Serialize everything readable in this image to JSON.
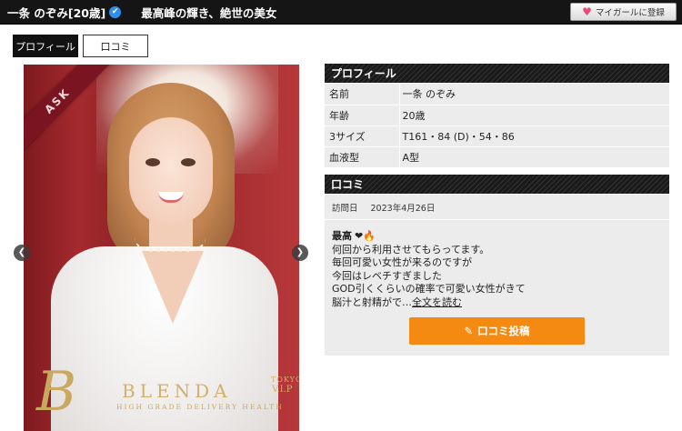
{
  "header": {
    "name": "一条 のぞみ[20歳]",
    "verified_icon": "✔",
    "catchphrase": "最高峰の輝き、絶世の美女",
    "favorite_button": "マイガールに登録"
  },
  "tabs": [
    {
      "label": "プロフィール",
      "active": true
    },
    {
      "label": "口コミ",
      "active": false
    }
  ],
  "photo": {
    "ribbon": "ASK",
    "brand_mark": "B",
    "brand_name": "BLENDA",
    "brand_tokyo": "TOKYO",
    "brand_vip": "V.I.P",
    "brand_tagline": "HIGH GRADE DELIVERY HEALTH"
  },
  "profile": {
    "title": "プロフィール",
    "rows": [
      {
        "key": "名前",
        "value": "一条 のぞみ"
      },
      {
        "key": "年齢",
        "value": "20歳"
      },
      {
        "key": "3サイズ",
        "value": "T161・84 (D)・54・86"
      },
      {
        "key": "血液型",
        "value": "A型"
      }
    ]
  },
  "review": {
    "title": "口コミ",
    "visit_label": "訪問日",
    "visit_date": "2023年4月26日",
    "heading": "最高",
    "heading_emoji": "❤🔥",
    "lines": [
      "何回から利用させてもらってます。",
      "毎回可愛い女性が来るのですが",
      "今回はレベチすぎました",
      "GOD引くくらいの確率で可愛い女性がきて"
    ],
    "last_line": "脳汁と射精がで…",
    "read_more": "全文を読む",
    "post_button": "口コミ投稿"
  },
  "colors": {
    "header_bg": "#151515",
    "accent_orange": "#f58a13",
    "row_bg": "#ececec"
  }
}
